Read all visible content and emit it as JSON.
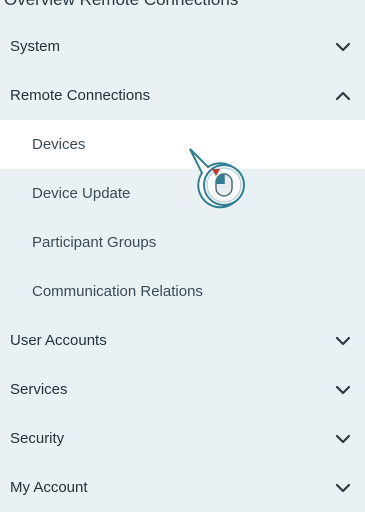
{
  "header_clip": "Overview Remote Connections",
  "menu": {
    "system": "System",
    "remote_connections": "Remote Connections",
    "sub_items": [
      "Devices",
      "Device Update",
      "Participant Groups",
      "Communication Relations"
    ],
    "user_accounts": "User Accounts",
    "services": "Services",
    "security": "Security",
    "my_account": "My Account"
  },
  "colors": {
    "panel_bg": "#eaf1f5",
    "active_bg": "#ffffff",
    "cursor_accent": "#2f7f92",
    "cursor_red": "#c0392b"
  },
  "icons": {
    "expand": "chevron-down-icon",
    "collapse": "chevron-up-icon",
    "cursor": "mouse-cursor-icon"
  }
}
